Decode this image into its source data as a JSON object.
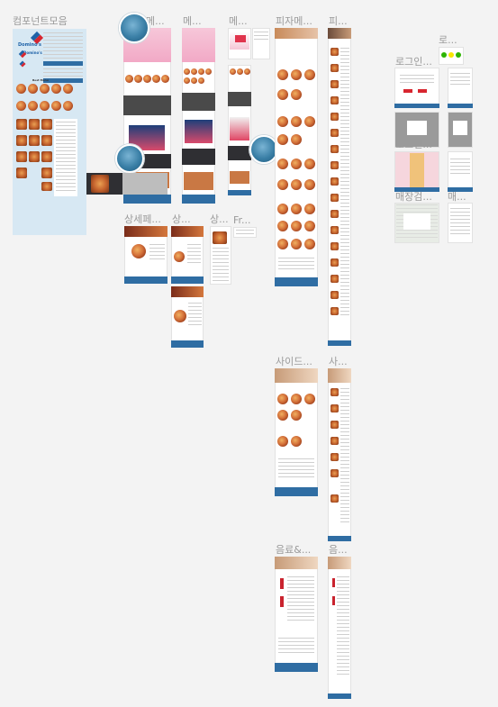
{
  "canvas": {
    "background": "#f3f3f3",
    "frame_labels": {
      "components": "컴포넌트모음",
      "main_1": "메...",
      "main_2": "메...",
      "main_3": "메...",
      "pizza_menu_1": "피자메...",
      "pizza_menu_2": "피...",
      "login_top": "로...",
      "login_1": "로그인...",
      "login_2": "로그인...",
      "store_search": "매장검...",
      "store_search_2": "매...",
      "product_detail_1": "상세페...",
      "product_detail_2": "상...",
      "product_detail_3": "상...",
      "fr": "Fr...",
      "side_menu_1": "사이드...",
      "side_menu_2": "사...",
      "drinks_1": "음료&...",
      "drinks_2": "음..."
    }
  },
  "components_panel": {
    "brand_1": "Domino's",
    "brand_2": "Domino's",
    "section_title": "Best Menu"
  },
  "colors": {
    "brand_blue": "#1f63a8",
    "brand_red": "#d8262f",
    "footer_blue": "#2f6da3",
    "panel_blue": "#d7e8f3",
    "label_gray": "#9a9a9a",
    "promo_pink": "#f2b7cf"
  },
  "icons": [
    "collaborator-avatar-icon",
    "dominos-logo-icon"
  ]
}
